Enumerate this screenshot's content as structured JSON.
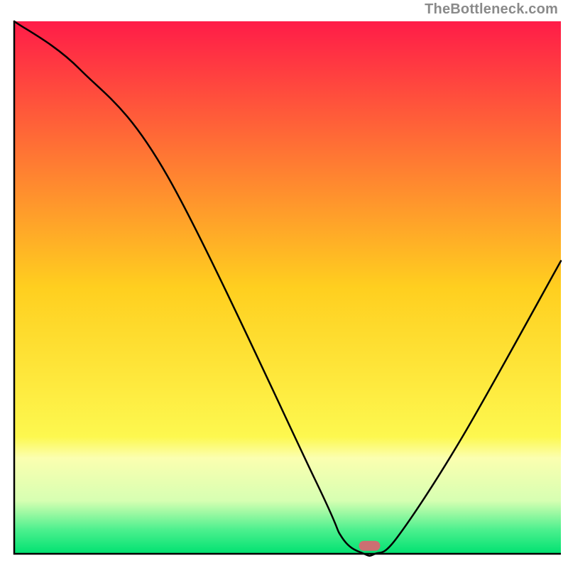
{
  "watermark": "TheBottleneck.com",
  "chart_data": {
    "type": "line",
    "title": "",
    "xlabel": "",
    "ylabel": "",
    "xlim": [
      0,
      100
    ],
    "ylim": [
      0,
      100
    ],
    "grid": false,
    "legend": false,
    "background_gradient": {
      "stops": [
        {
          "offset": 0.0,
          "color": "#ff1c48"
        },
        {
          "offset": 0.5,
          "color": "#ffcf1f"
        },
        {
          "offset": 0.78,
          "color": "#fdf84f"
        },
        {
          "offset": 0.82,
          "color": "#fbffb0"
        },
        {
          "offset": 0.9,
          "color": "#d7ffb2"
        },
        {
          "offset": 0.955,
          "color": "#4cf08e"
        },
        {
          "offset": 1.0,
          "color": "#00e171"
        }
      ]
    },
    "series": [
      {
        "name": "bottleneck-curve",
        "x": [
          0,
          12,
          28,
          55,
          60,
          64,
          66,
          70,
          82,
          100
        ],
        "y": [
          100,
          91,
          71,
          14,
          3,
          0,
          0,
          3,
          22,
          55
        ]
      }
    ],
    "marker": {
      "name": "optimal-point",
      "x": 65,
      "y": 1.5,
      "color": "#cc6f72"
    },
    "axis": {
      "color": "#000000",
      "width": 2.5
    },
    "curve_style": {
      "color": "#000000",
      "width": 2.5
    }
  }
}
